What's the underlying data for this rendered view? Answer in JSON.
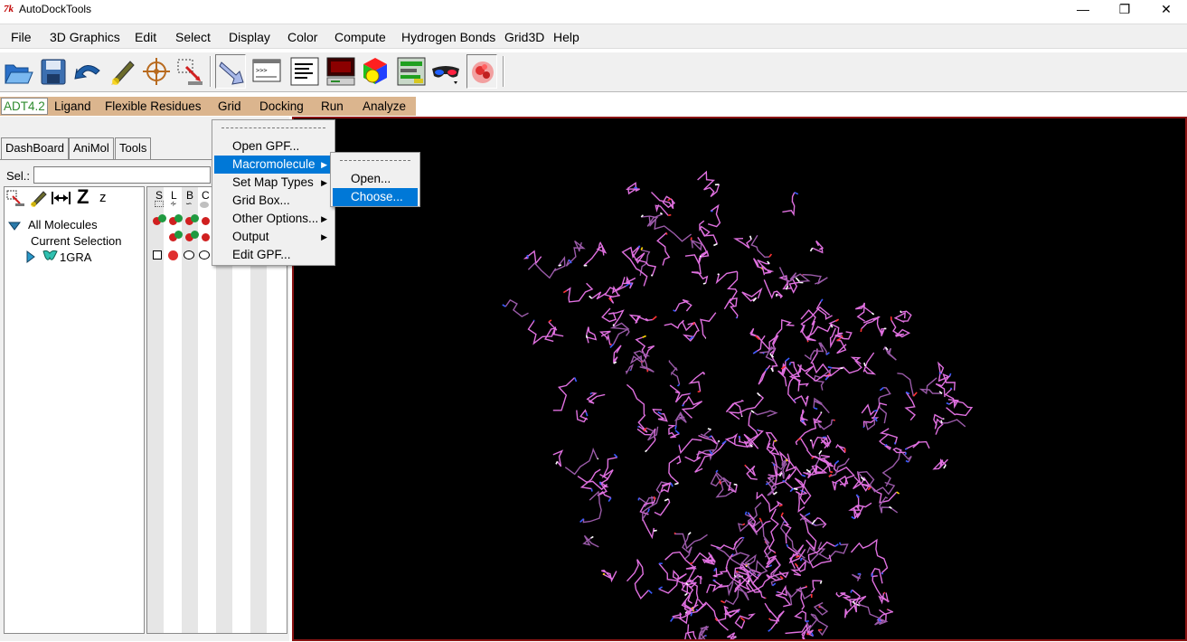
{
  "window": {
    "title": "AutoDockTools",
    "icon_letters": "7k",
    "controls": [
      "minimize",
      "restore",
      "close"
    ]
  },
  "menubar": [
    "File",
    "3D Graphics",
    "Edit",
    "Select",
    "Display",
    "Color",
    "Compute",
    "Hydrogen Bonds",
    "Grid3D",
    "Help"
  ],
  "toolbar": {
    "icons": [
      "open-folder-icon",
      "save-disk-icon",
      "undo-arrow-icon",
      "pencil-select-icon",
      "crosshair-center-icon",
      "select-box-icon",
      "pointer-hand-icon",
      "python-shell-icon",
      "align-text-icon",
      "monitor-icon",
      "color-cube-icon",
      "grid-panel-icon",
      "stereo-glasses-icon",
      "molecule-surface-icon"
    ]
  },
  "tabs": {
    "active": "ADT4.2",
    "items": [
      "Ligand",
      "Flexible Residues",
      "Grid",
      "Docking",
      "Run",
      "Analyze"
    ]
  },
  "left_panel": {
    "tabs": [
      "DashBoard",
      "AniMol",
      "Tools"
    ],
    "sel_label": "Sel.:",
    "sel_value": "",
    "tree_tool_z": "Z",
    "tree_tool_z_small": "z",
    "columns": [
      "S",
      "L",
      "B",
      "C"
    ],
    "tree": {
      "root": "All Molecules",
      "current": "Current Selection",
      "molecule": "1GRA"
    }
  },
  "grid_menu": {
    "items": [
      {
        "label": "Open GPF...",
        "submenu": false
      },
      {
        "label": "Macromolecule",
        "submenu": true
      },
      {
        "label": "Set Map Types",
        "submenu": true
      },
      {
        "label": "Grid Box...",
        "submenu": false
      },
      {
        "label": "Other Options...",
        "submenu": true
      },
      {
        "label": "Output",
        "submenu": true
      },
      {
        "label": "Edit GPF...",
        "submenu": false
      }
    ],
    "highlighted": "Macromolecule"
  },
  "macromolecule_submenu": {
    "items": [
      "Open...",
      "Choose..."
    ],
    "highlighted": "Choose..."
  },
  "viewer": {
    "background": "#000000",
    "border_color": "#8b1414",
    "stick_color": "#e070e0",
    "nitrogen_color": "#3a5cff",
    "hydrogen_color": "#ffffff",
    "oxygen_color": "#ff3333",
    "sulfur_color": "#ffd700"
  }
}
